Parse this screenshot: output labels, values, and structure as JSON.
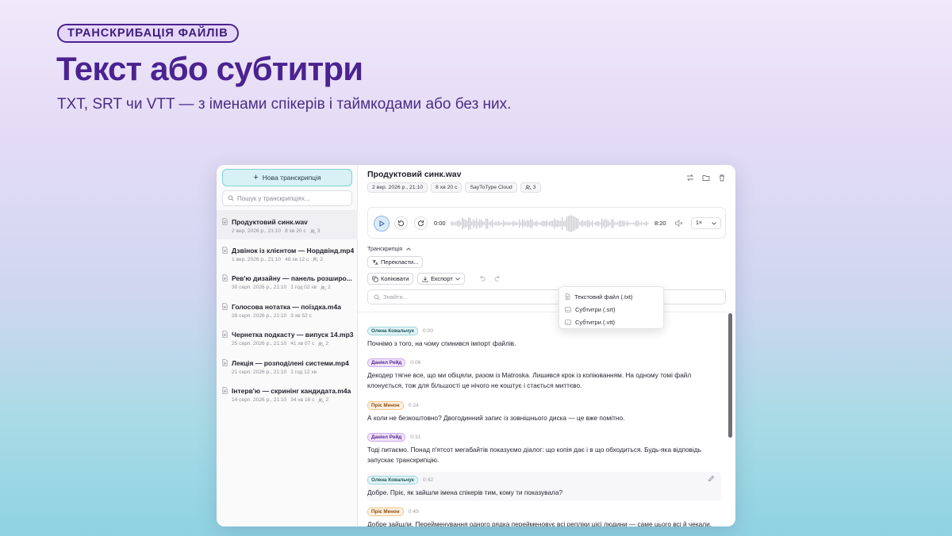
{
  "hero": {
    "badge": "ТРАНСКРИБАЦІЯ ФАЙЛІВ",
    "title": "Текст або субтитри",
    "subtitle": "TXT, SRT чи VTT — з іменами спікерів і таймкодами або без них."
  },
  "sidebar": {
    "new_button": "Нова транскрипція",
    "search_placeholder": "Пошук у транскрипціях...",
    "items": [
      {
        "title": "Продуктовий синк.wav",
        "date": "2 вер. 2026 р., 21:10",
        "duration": "8 хв 20 с",
        "speakers": "3",
        "active": true
      },
      {
        "title": "Дзвінок із клієнтом — Нордвінд.mp4",
        "date": "1 вер. 2026 р., 21:10",
        "duration": "48 хв 12 с",
        "speakers": "2",
        "active": false
      },
      {
        "title": "Рев'ю дизайну — панель розширо...",
        "date": "30 серп. 2026 р., 21:10",
        "duration": "1 год 02 хв",
        "speakers": "2",
        "active": false
      },
      {
        "title": "Голосова нотатка — поїздка.m4a",
        "date": "28 серп. 2026 р., 21:10",
        "duration": "3 хв 52 с",
        "speakers": "",
        "active": false
      },
      {
        "title": "Чернетка подкасту — випуск 14.mp3",
        "date": "25 серп. 2026 р., 21:10",
        "duration": "41 хв 07 с",
        "speakers": "2",
        "active": false
      },
      {
        "title": "Лекція — розподілені системи.mp4",
        "date": "21 серп. 2026 р., 21:10",
        "duration": "1 год 12 хв",
        "speakers": "",
        "active": false
      },
      {
        "title": "Інтерв'ю — скринінг кандидата.m4a",
        "date": "14 серп. 2026 р., 21:10",
        "duration": "34 хв 18 с",
        "speakers": "2",
        "active": false
      }
    ]
  },
  "main": {
    "file_title": "Продуктовий синк.wav",
    "chips": {
      "date": "2 вер. 2026 р., 21:10",
      "duration": "8 хв 20 с",
      "engine": "SayToType Cloud",
      "speakers": "3"
    },
    "player": {
      "current": "0:00",
      "total": "8:20",
      "speed": "1×",
      "progress": 0
    },
    "section_label": "Транскрипція",
    "translate_button": "Перекласти...",
    "copy_button": "Копіювати",
    "export_button": "Експорт",
    "find_placeholder": "Знайти...",
    "export_menu": [
      "Текстовий файл (.txt)",
      "Субтитри (.srt)",
      "Субтитри (.vtt)"
    ],
    "segments": [
      {
        "speaker": "Олена Ковальчук",
        "class": "olena",
        "time": "0:00",
        "lines": [
          "Почнімо з того, на чому спинився імпорт файлів."
        ]
      },
      {
        "speaker": "Даніел Рейд",
        "class": "daniel",
        "time": "0:06",
        "lines": [
          "Декодер тягне все, що ми обіцяли, разом із Matroska. Лишився крок із копіюванням. На одному томі файл",
          "клонується, тож для більшості це нічого не коштує і стається миттєво."
        ]
      },
      {
        "speaker": "Пріє Менон",
        "class": "priya",
        "time": "0:24",
        "lines": [
          "А коли не безкоштовно? Двогодинний запис із зовнішнього диска — це вже помітно."
        ]
      },
      {
        "speaker": "Даніел Рейд",
        "class": "daniel",
        "time": "0:31",
        "lines": [
          "Тоді питаємо. Понад п'ятсот мегабайтів показуємо діалог: що копія дає і в що обходиться. Будь-яка відповідь",
          "запускає транскрипцію."
        ]
      },
      {
        "speaker": "Олена Ковальчук",
        "class": "olena",
        "time": "0:42",
        "lines": [
          "Добре. Пріє, як зайшли імена спікерів тим, кому ти показувала?"
        ],
        "highlight": true
      },
      {
        "speaker": "Пріє Менон",
        "class": "priya",
        "time": "0:49",
        "lines": [
          "Добре зайшли. Перейменування одного рядка перейменовує всі репліки цієї людини — саме цього всі й чекали."
        ]
      }
    ]
  }
}
